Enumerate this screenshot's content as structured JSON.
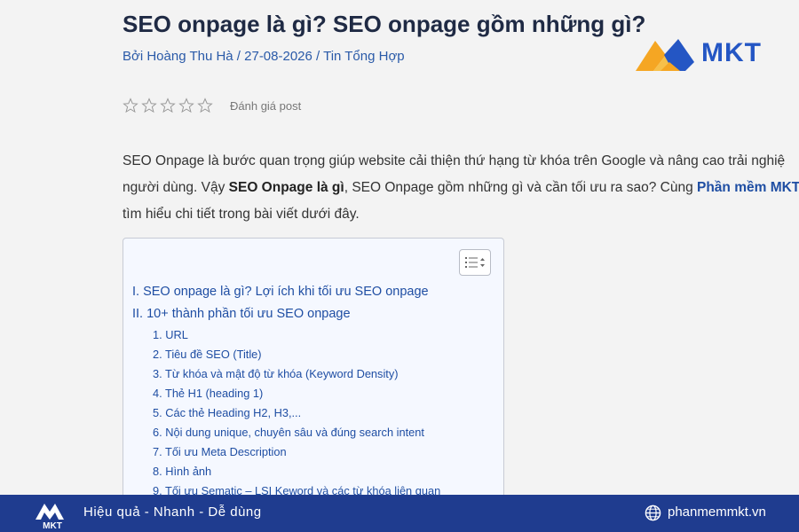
{
  "article": {
    "title": "SEO onpage là gì? SEO onpage gồm những gì?",
    "meta": "Bởi Hoàng Thu Hà / 27-08-2026 / Tin Tổng Hợp",
    "rating_label": "Đánh giá post",
    "rating_value": 0,
    "rating_max": 5,
    "intro_line1": "SEO Onpage là bước quan trọng giúp website cải thiện thứ hạng từ khóa trên Google và nâng cao trải nghiệ",
    "intro_line2_a": "người dùng. Vậy ",
    "intro_line2_bold": "SEO Onpage là gì",
    "intro_line2_b": ", SEO Onpage gồm những gì và cần tối ưu ra sao? Cùng ",
    "intro_line2_link": "Phần mềm MKT",
    "intro_line3": "tìm hiểu chi tiết trong bài viết dưới đây."
  },
  "brand": {
    "logo_text": "MKT"
  },
  "toc": {
    "items": [
      {
        "level": 2,
        "text": "I. SEO onpage là gì? Lợi ích khi tối ưu SEO onpage"
      },
      {
        "level": 2,
        "text": "II. 10+ thành phần tối ưu SEO onpage"
      },
      {
        "level": 3,
        "text": "1. URL"
      },
      {
        "level": 3,
        "text": "2. Tiêu đề SEO (Title)"
      },
      {
        "level": 3,
        "text": "3. Từ khóa và mật độ từ khóa (Keyword Density)"
      },
      {
        "level": 3,
        "text": "4. Thẻ H1 (heading 1)"
      },
      {
        "level": 3,
        "text": "5. Các thẻ Heading H2, H3,..."
      },
      {
        "level": 3,
        "text": "6. Nội dung unique, chuyên sâu và đúng search intent"
      },
      {
        "level": 3,
        "text": "7. Tối ưu Meta Description"
      },
      {
        "level": 3,
        "text": "8. Hình ảnh"
      },
      {
        "level": 3,
        "text": "9. Tối ưu Sematic – LSI Keword và các từ khóa liên quan"
      }
    ]
  },
  "footer": {
    "logo_text": "MKT",
    "tagline": "Hiệu quả - Nhanh - Dễ dùng",
    "website": "phanmemmkt.vn"
  },
  "colors": {
    "footer_bg": "#1f3c8f",
    "link": "#1f4ea3",
    "brand_blue": "#2456c4",
    "brand_orange": "#f5a623"
  }
}
